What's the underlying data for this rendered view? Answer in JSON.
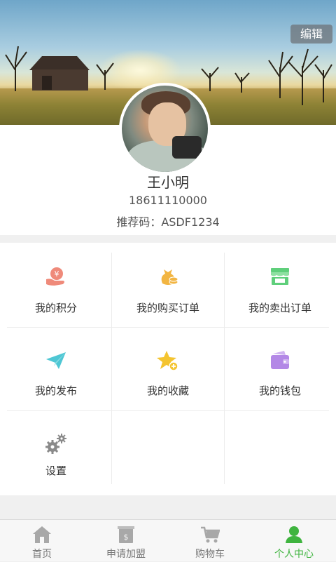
{
  "header": {
    "edit_label": "编辑"
  },
  "profile": {
    "name": "王小明",
    "phone": "18611110000",
    "referral_label": "推荐码：",
    "referral_code": "ASDF1234"
  },
  "menu": [
    {
      "label": "我的积分",
      "icon": "points-yen-icon",
      "color": "#ef8a7a"
    },
    {
      "label": "我的购买订单",
      "icon": "money-bag-icon",
      "color": "#f2b542"
    },
    {
      "label": "我的卖出订单",
      "icon": "shop-icon",
      "color": "#5fcf7b"
    },
    {
      "label": "我的发布",
      "icon": "paper-plane-icon",
      "color": "#4fc7d4"
    },
    {
      "label": "我的收藏",
      "icon": "star-plus-icon",
      "color": "#f4c430"
    },
    {
      "label": "我的钱包",
      "icon": "wallet-icon",
      "color": "#b388e6"
    },
    {
      "label": "设置",
      "icon": "gear-icon",
      "color": "#8a8a8a"
    }
  ],
  "tabbar": [
    {
      "label": "首页",
      "icon": "home-icon",
      "active": false
    },
    {
      "label": "申请加盟",
      "icon": "franchise-icon",
      "active": false
    },
    {
      "label": "购物车",
      "icon": "cart-icon",
      "active": false
    },
    {
      "label": "个人中心",
      "icon": "person-icon",
      "active": true
    }
  ],
  "colors": {
    "accent": "#3fb43f",
    "inactive": "#9a9a9a"
  }
}
